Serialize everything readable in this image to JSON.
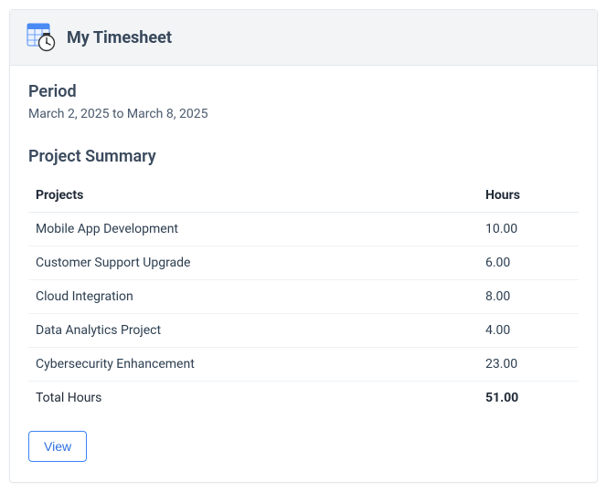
{
  "header": {
    "title": "My Timesheet"
  },
  "period": {
    "label": "Period",
    "value": "March 2, 2025 to March 8, 2025"
  },
  "summary": {
    "title": "Project Summary",
    "columns": {
      "projects": "Projects",
      "hours": "Hours"
    },
    "rows": [
      {
        "project": "Mobile App Development",
        "hours": "10.00"
      },
      {
        "project": "Customer Support Upgrade",
        "hours": "6.00"
      },
      {
        "project": "Cloud Integration",
        "hours": "8.00"
      },
      {
        "project": "Data Analytics Project",
        "hours": "4.00"
      },
      {
        "project": "Cybersecurity Enhancement",
        "hours": "23.00"
      }
    ],
    "total": {
      "label": "Total Hours",
      "hours": "51.00"
    }
  },
  "actions": {
    "view": "View"
  }
}
